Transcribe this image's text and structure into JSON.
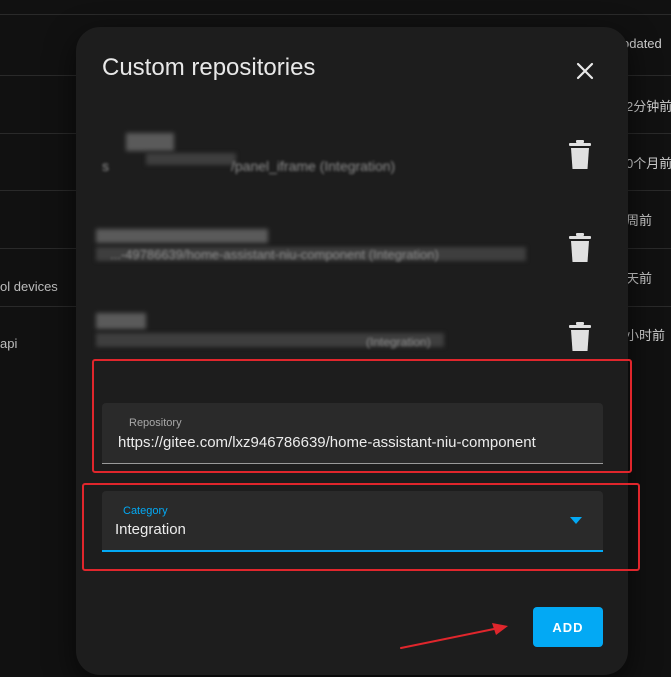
{
  "background": {
    "header_right": "odated",
    "right_column": [
      "2分钟前",
      "0个月前",
      "周前",
      "天前",
      "小时前"
    ],
    "left_column": [
      "ol devices",
      "api"
    ]
  },
  "dialog": {
    "title": "Custom repositories",
    "close_icon": "close-icon",
    "repositories": [
      {
        "name": "s",
        "detail": "/panel_iframe (Integration)"
      },
      {
        "name": "",
        "detail": "...-49786639/home-assistant-niu-component (Integration)"
      },
      {
        "name": "",
        "detail": "(Integration)"
      }
    ],
    "trash_icon": "trash-icon",
    "repository_field": {
      "label": "Repository",
      "value": "https://gitee.com/lxz946786639/home-assistant-niu-component"
    },
    "category_field": {
      "label": "Category",
      "value": "Integration",
      "dropdown_icon": "triangle-down-icon"
    },
    "add_button": "ADD"
  },
  "colors": {
    "accent": "#03a9f4",
    "annotation": "#e0262c",
    "dialog_bg": "#1d1d1d",
    "field_bg": "#2a2a2a"
  }
}
